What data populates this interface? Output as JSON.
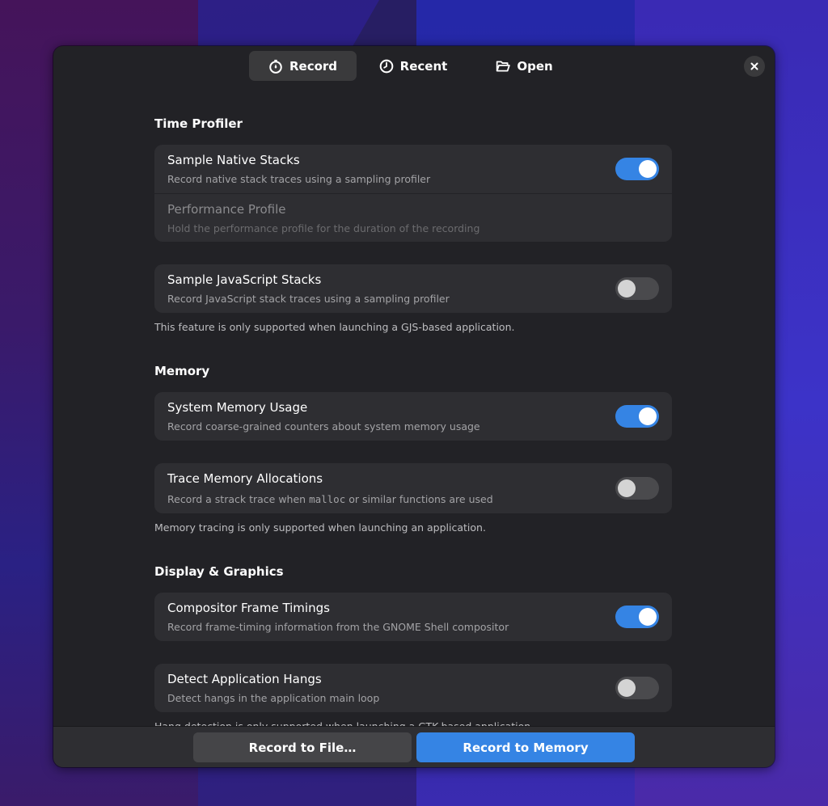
{
  "header": {
    "tabs": [
      {
        "label": "Record",
        "icon": "stopwatch-icon",
        "active": true
      },
      {
        "label": "Recent",
        "icon": "clock-icon",
        "active": false
      },
      {
        "label": "Open",
        "icon": "folder-open-icon",
        "active": false
      }
    ],
    "close_icon": "close-icon"
  },
  "sections": [
    {
      "title": "Time Profiler",
      "groups": [
        {
          "rows": [
            {
              "title": "Sample Native Stacks",
              "subtitle": "Record native stack traces using a sampling profiler",
              "toggle": true,
              "disabled": false
            },
            {
              "title": "Performance Profile",
              "subtitle": "Hold the performance profile for the duration of the recording",
              "toggle": null,
              "disabled": true
            }
          ]
        },
        {
          "rows": [
            {
              "title": "Sample JavaScript Stacks",
              "subtitle": "Record JavaScript stack traces using a sampling profiler",
              "toggle": false,
              "disabled": false
            }
          ],
          "note": "This feature is only supported when launching a GJS-based application."
        }
      ]
    },
    {
      "title": "Memory",
      "groups": [
        {
          "rows": [
            {
              "title": "System Memory Usage",
              "subtitle": "Record coarse-grained counters about system memory usage",
              "toggle": true,
              "disabled": false
            }
          ]
        },
        {
          "rows": [
            {
              "title": "Trace Memory Allocations",
              "subtitle_pre": "Record a strack trace when ",
              "subtitle_code": "malloc",
              "subtitle_post": " or similar functions are used",
              "toggle": false,
              "disabled": false
            }
          ],
          "note": "Memory tracing is only supported when launching an application."
        }
      ]
    },
    {
      "title": "Display & Graphics",
      "groups": [
        {
          "rows": [
            {
              "title": "Compositor Frame Timings",
              "subtitle": "Record frame-timing information from the GNOME Shell compositor",
              "toggle": true,
              "disabled": false
            }
          ]
        },
        {
          "rows": [
            {
              "title": "Detect Application Hangs",
              "subtitle": "Detect hangs in the application main loop",
              "toggle": false,
              "disabled": false
            }
          ],
          "note": "Hang detection is only supported when launching a GTK-based application."
        }
      ]
    }
  ],
  "footer": {
    "record_to_file": "Record to File…",
    "record_to_memory": "Record to Memory"
  },
  "colors": {
    "accent": "#3584e4",
    "window_bg": "#222226",
    "card_bg": "#2e2e32"
  }
}
